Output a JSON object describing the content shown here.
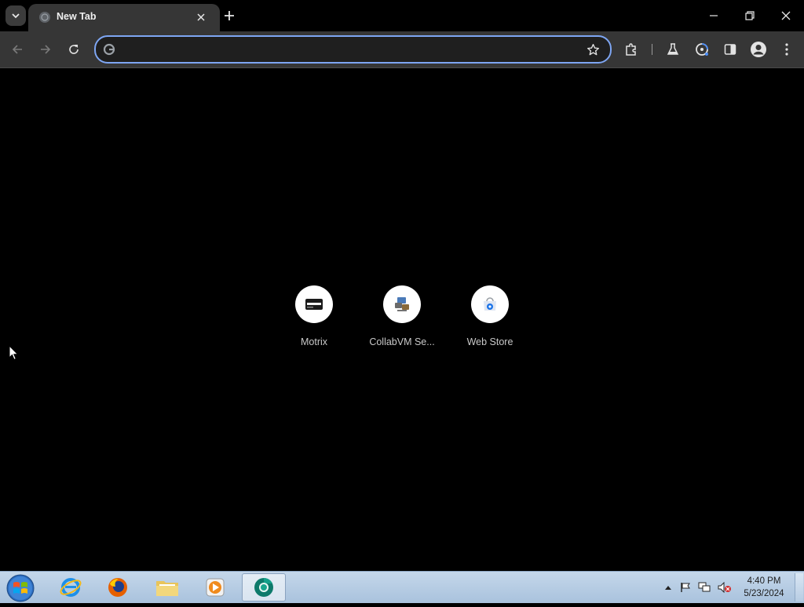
{
  "browser": {
    "tab": {
      "title": "New Tab"
    },
    "omnibox": {
      "value": "",
      "placeholder": ""
    }
  },
  "shortcuts": [
    {
      "label": "Motrix",
      "icon": "motrix-icon"
    },
    {
      "label": "CollabVM Se...",
      "icon": "collabvm-icon"
    },
    {
      "label": "Web Store",
      "icon": "web-store-icon"
    }
  ],
  "taskbar": {
    "apps": [
      {
        "name": "internet-explorer",
        "icon": "ie-icon"
      },
      {
        "name": "firefox",
        "icon": "firefox-icon"
      },
      {
        "name": "file-explorer",
        "icon": "folder-icon"
      },
      {
        "name": "media-player",
        "icon": "media-player-icon"
      },
      {
        "name": "chrome",
        "icon": "chrome-icon",
        "active": true
      }
    ],
    "clock": {
      "time": "4:40 PM",
      "date": "5/23/2024"
    }
  },
  "colors": {
    "page_background": "#000000",
    "toolbar": "#363636",
    "omnibox_focus": "#7ea6f3",
    "taskbar": "#b8cde4"
  }
}
